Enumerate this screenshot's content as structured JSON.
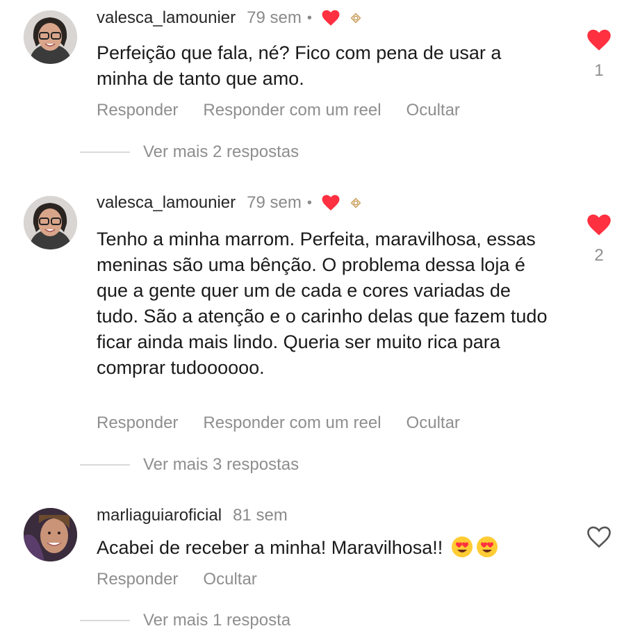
{
  "comments": [
    {
      "username": "valesca_lamounier",
      "time": "79 sem",
      "separator": "•",
      "text": "Perfeição que fala, né? Fico com pena de usar a minha de tanto que amo.",
      "likes": "1",
      "liked": true,
      "actions": [
        "Responder",
        "Responder com um reel",
        "Ocultar"
      ],
      "view_replies": "Ver mais 2 respostas"
    },
    {
      "username": "valesca_lamounier",
      "time": "79 sem",
      "separator": "•",
      "text": "Tenho a minha marrom. Perfeita, maravilhosa, essas meninas são uma bênção. O problema dessa loja é que a gente quer um de cada e cores variadas de tudo. São a atenção e o carinho delas que fazem tudo ficar ainda mais lindo. Queria ser muito rica para comprar tudoooooo.",
      "likes": "2",
      "liked": true,
      "actions": [
        "Responder",
        "Responder com um reel",
        "Ocultar"
      ],
      "view_replies": "Ver mais 3 respostas"
    },
    {
      "username": "marliaguiaroficial",
      "time": "81 sem",
      "text": "Acabei de receber a minha! Maravilhosa!!",
      "liked": false,
      "actions": [
        "Responder",
        "Ocultar"
      ],
      "view_replies": "Ver mais 1 resposta"
    }
  ],
  "colors": {
    "heart": "#ff3040",
    "muted": "#8e8e8e",
    "text": "#1a1a1a"
  },
  "icons": {
    "liked": "heart-filled-icon",
    "unliked": "heart-outline-icon",
    "author_reaction": "heart-filled-icon",
    "badge": "flower-badge-icon",
    "emoji": "heart-eyes-emoji"
  }
}
